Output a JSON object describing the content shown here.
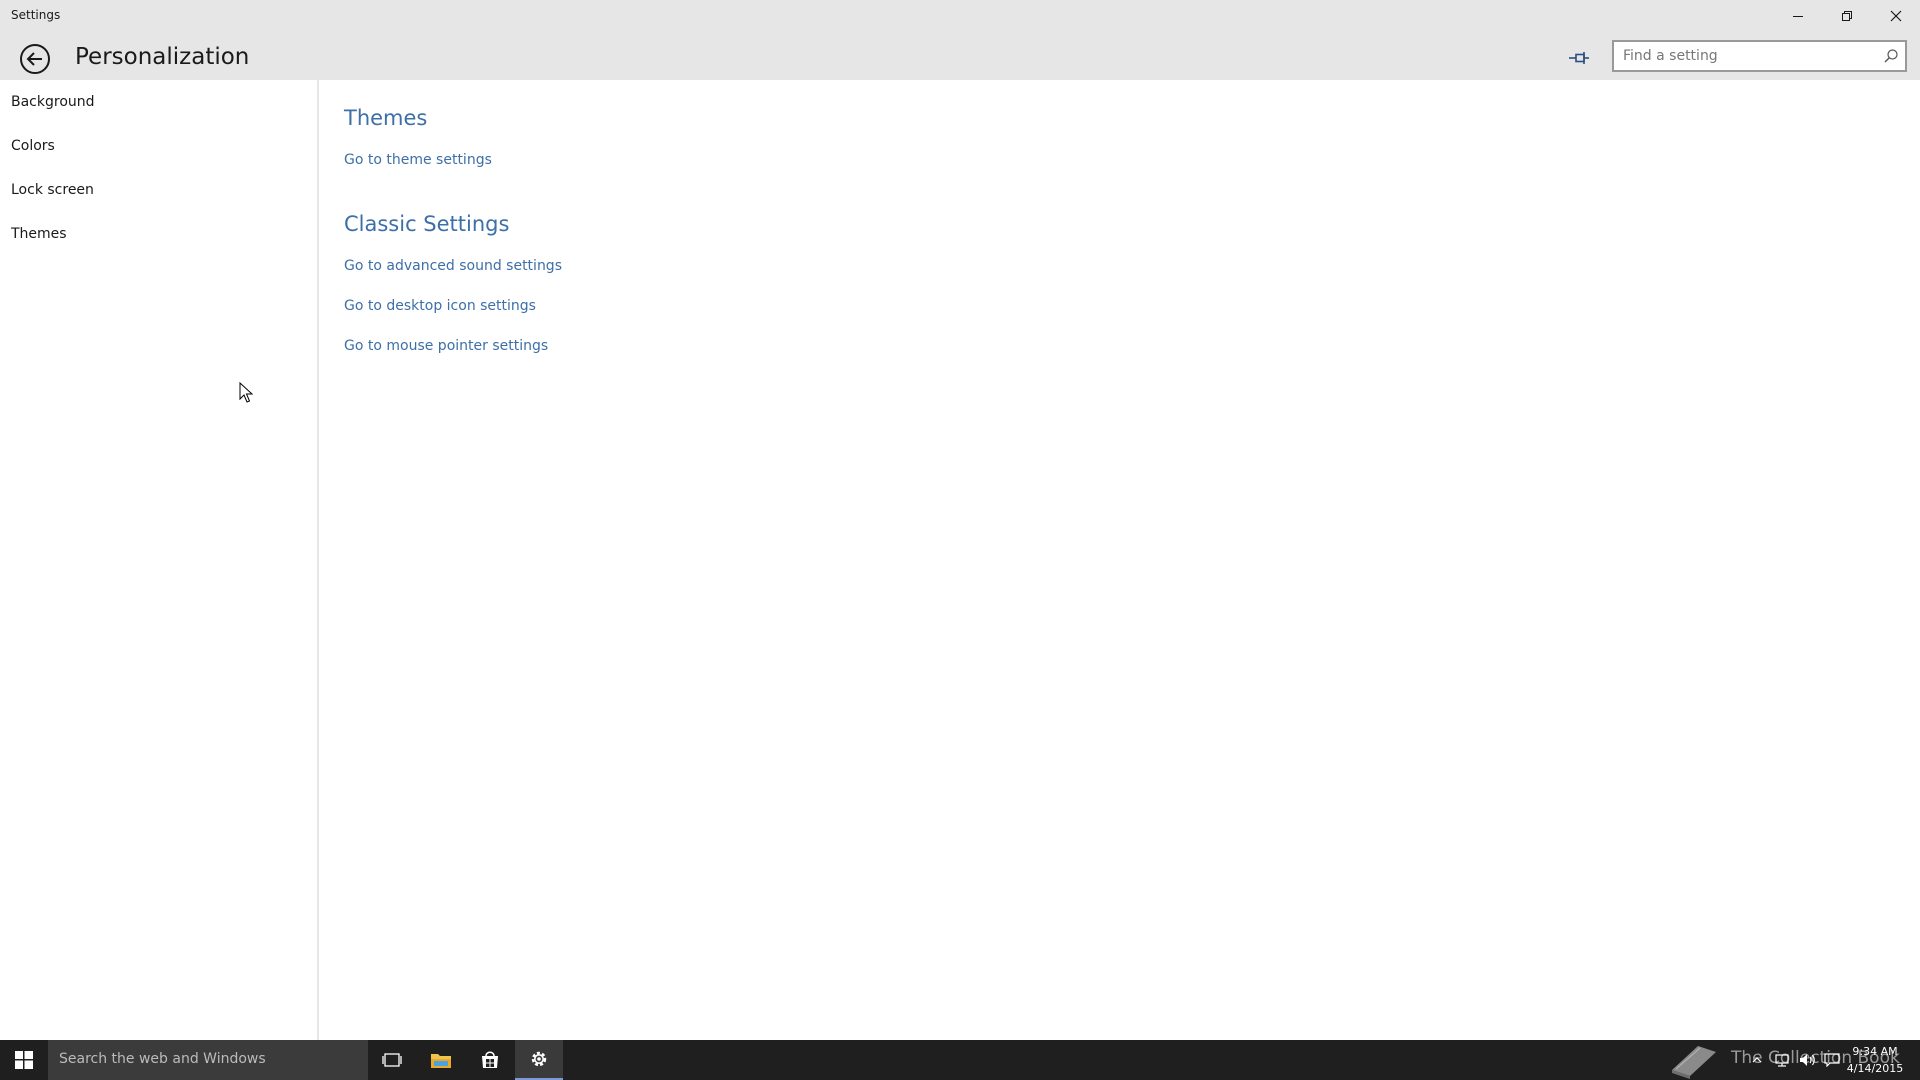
{
  "window": {
    "title": "Settings"
  },
  "header": {
    "page_title": "Personalization",
    "search_placeholder": "Find a setting"
  },
  "sidebar": {
    "items": [
      {
        "label": "Background"
      },
      {
        "label": "Colors"
      },
      {
        "label": "Lock screen"
      },
      {
        "label": "Themes"
      }
    ]
  },
  "main": {
    "themes_heading": "Themes",
    "themes_link": "Go to theme settings",
    "classic_heading": "Classic Settings",
    "classic_links": [
      {
        "label": "Go to advanced sound settings"
      },
      {
        "label": "Go to desktop icon settings"
      },
      {
        "label": "Go to mouse pointer settings"
      }
    ]
  },
  "taskbar": {
    "search_placeholder": "Search the web and Windows",
    "watermark_text": "The Collection Book",
    "clock_time": "9:34 AM",
    "clock_date": "4/14/2015"
  },
  "colors": {
    "accent_link": "#3d6fa8",
    "chrome": "#e6e6e6",
    "taskbar": "#1f1f1f",
    "settings_active": "#7a9ad8"
  },
  "icons": {
    "back": "back-arrow-icon",
    "pin": "pin-icon",
    "search": "search-icon",
    "start": "windows-logo-icon",
    "task_view": "task-view-icon",
    "file_explorer": "folder-icon",
    "store": "store-icon",
    "settings": "gear-icon"
  }
}
